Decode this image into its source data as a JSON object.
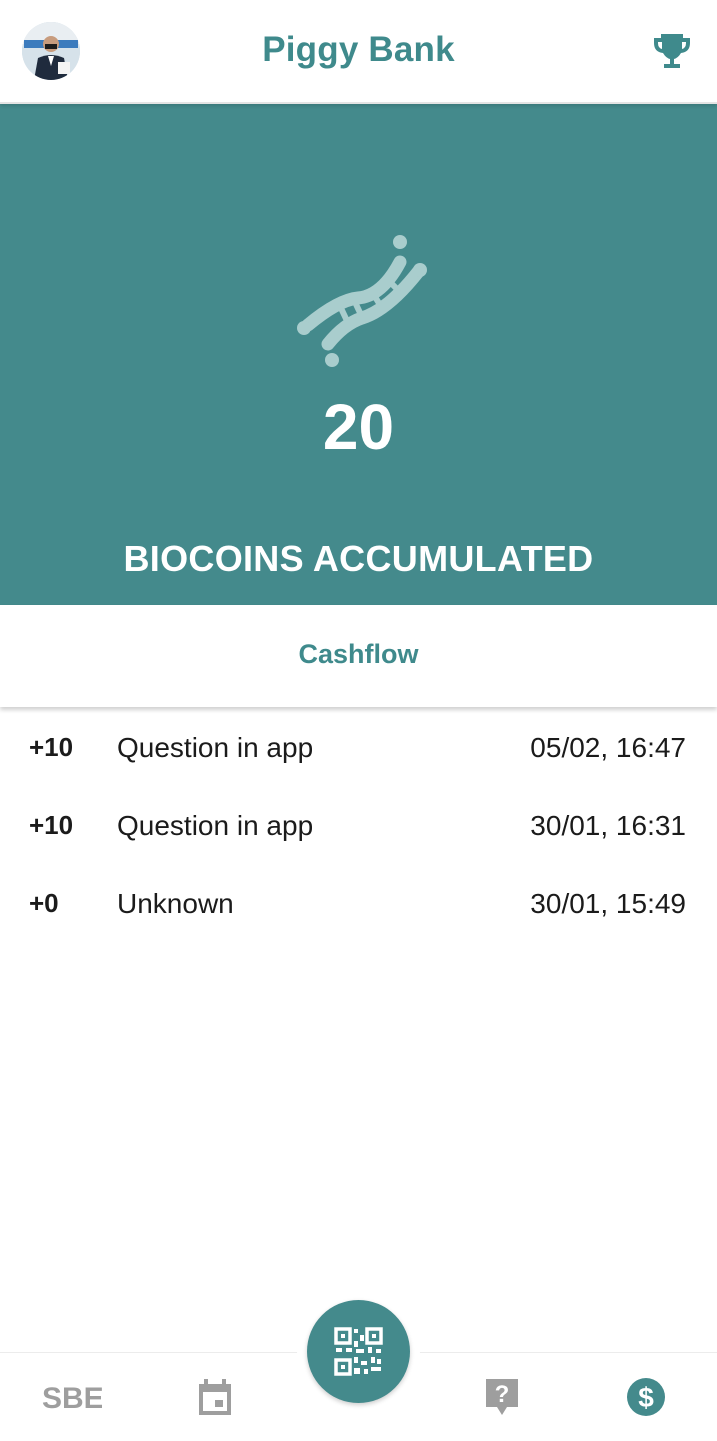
{
  "header": {
    "title": "Piggy Bank",
    "avatar_icon": "profile-avatar",
    "trophy_icon": "trophy-icon"
  },
  "hero": {
    "icon": "dna-icon",
    "amount": "20",
    "caption": "BIOCOINS ACCUMULATED",
    "background": "#448a8c"
  },
  "tabs": {
    "cashflow_label": "Cashflow"
  },
  "transactions": [
    {
      "amount": "+10",
      "description": "Question in app",
      "datetime": "05/02, 16:47"
    },
    {
      "amount": "+10",
      "description": "Question in app",
      "datetime": "30/01, 16:31"
    },
    {
      "amount": "+0",
      "description": "Unknown",
      "datetime": "30/01, 15:49"
    }
  ],
  "bottom_nav": {
    "items": [
      {
        "icon": "sbe-logo-icon",
        "label": "SBE"
      },
      {
        "icon": "calendar-icon"
      },
      {
        "icon": "qr-code-icon"
      },
      {
        "icon": "question-icon"
      },
      {
        "icon": "dollar-icon"
      }
    ],
    "accent": "#448a8c",
    "inactive": "#9e9e9e"
  }
}
